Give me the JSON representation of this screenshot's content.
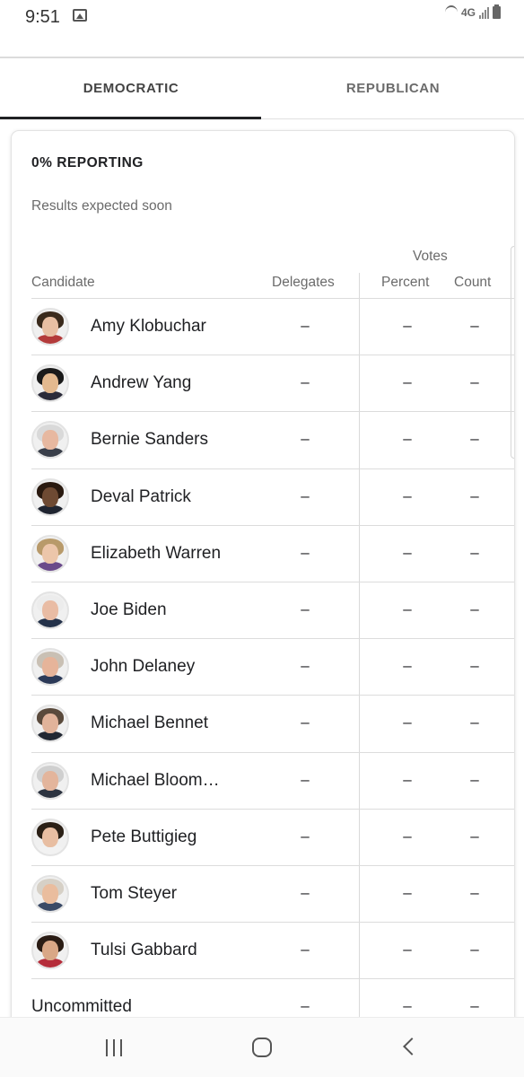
{
  "status_bar": {
    "time": "9:51",
    "network": "4G"
  },
  "tabs": [
    {
      "label": "DEMOCRATIC",
      "active": true
    },
    {
      "label": "REPUBLICAN",
      "active": false
    }
  ],
  "results": {
    "reporting": "0% REPORTING",
    "subtitle": "Results expected soon",
    "headers": {
      "votes": "Votes",
      "candidate": "Candidate",
      "delegates": "Delegates",
      "percent": "Percent",
      "count": "Count"
    },
    "rows": [
      {
        "name": "Amy Klobuchar",
        "delegates": "–",
        "percent": "–",
        "count": "–",
        "avatar": {
          "hair": "#3a2a1c",
          "face": "#e8bfa3",
          "body": "#b33a3a"
        }
      },
      {
        "name": "Andrew Yang",
        "delegates": "–",
        "percent": "–",
        "count": "–",
        "avatar": {
          "hair": "#1a1a1a",
          "face": "#e3b98f",
          "body": "#2b2b3a"
        }
      },
      {
        "name": "Bernie Sanders",
        "delegates": "–",
        "percent": "–",
        "count": "–",
        "avatar": {
          "hair": "#d9d9d9",
          "face": "#e7b8a0",
          "body": "#3a3f4a"
        }
      },
      {
        "name": "Deval Patrick",
        "delegates": "–",
        "percent": "–",
        "count": "–",
        "avatar": {
          "hair": "#2a1a10",
          "face": "#6e4a33",
          "body": "#1f2430"
        }
      },
      {
        "name": "Elizabeth Warren",
        "delegates": "–",
        "percent": "–",
        "count": "–",
        "avatar": {
          "hair": "#b89a6a",
          "face": "#ecc6aa",
          "body": "#6a4a8a"
        }
      },
      {
        "name": "Joe Biden",
        "delegates": "–",
        "percent": "–",
        "count": "–",
        "avatar": {
          "hair": "#ececec",
          "face": "#e9bca4",
          "body": "#24324a"
        }
      },
      {
        "name": "John Delaney",
        "delegates": "–",
        "percent": "–",
        "count": "–",
        "avatar": {
          "hair": "#c9c0b4",
          "face": "#e6b49a",
          "body": "#2c3a58"
        }
      },
      {
        "name": "Michael Bennet",
        "delegates": "–",
        "percent": "–",
        "count": "–",
        "avatar": {
          "hair": "#5a4a3c",
          "face": "#e1b39a",
          "body": "#222833"
        }
      },
      {
        "name": "Michael Bloom…",
        "delegates": "–",
        "percent": "–",
        "count": "–",
        "avatar": {
          "hair": "#cfcfcf",
          "face": "#e3b59c",
          "body": "#2c3340"
        }
      },
      {
        "name": "Pete Buttigieg",
        "delegates": "–",
        "percent": "–",
        "count": "–",
        "avatar": {
          "hair": "#2b2016",
          "face": "#e8bea2",
          "body": "#f2f2f2"
        }
      },
      {
        "name": "Tom Steyer",
        "delegates": "–",
        "percent": "–",
        "count": "–",
        "avatar": {
          "hair": "#d6d0c6",
          "face": "#eabd9e",
          "body": "#3a4a66"
        }
      },
      {
        "name": "Tulsi Gabbard",
        "delegates": "–",
        "percent": "–",
        "count": "–",
        "avatar": {
          "hair": "#2a1c14",
          "face": "#d9a786",
          "body": "#b52d3a"
        }
      },
      {
        "name": "Uncommitted",
        "delegates": "–",
        "percent": "–",
        "count": "–",
        "avatar": null
      }
    ]
  },
  "nav": {
    "icons": [
      "recents-icon",
      "home-icon",
      "back-icon"
    ]
  }
}
